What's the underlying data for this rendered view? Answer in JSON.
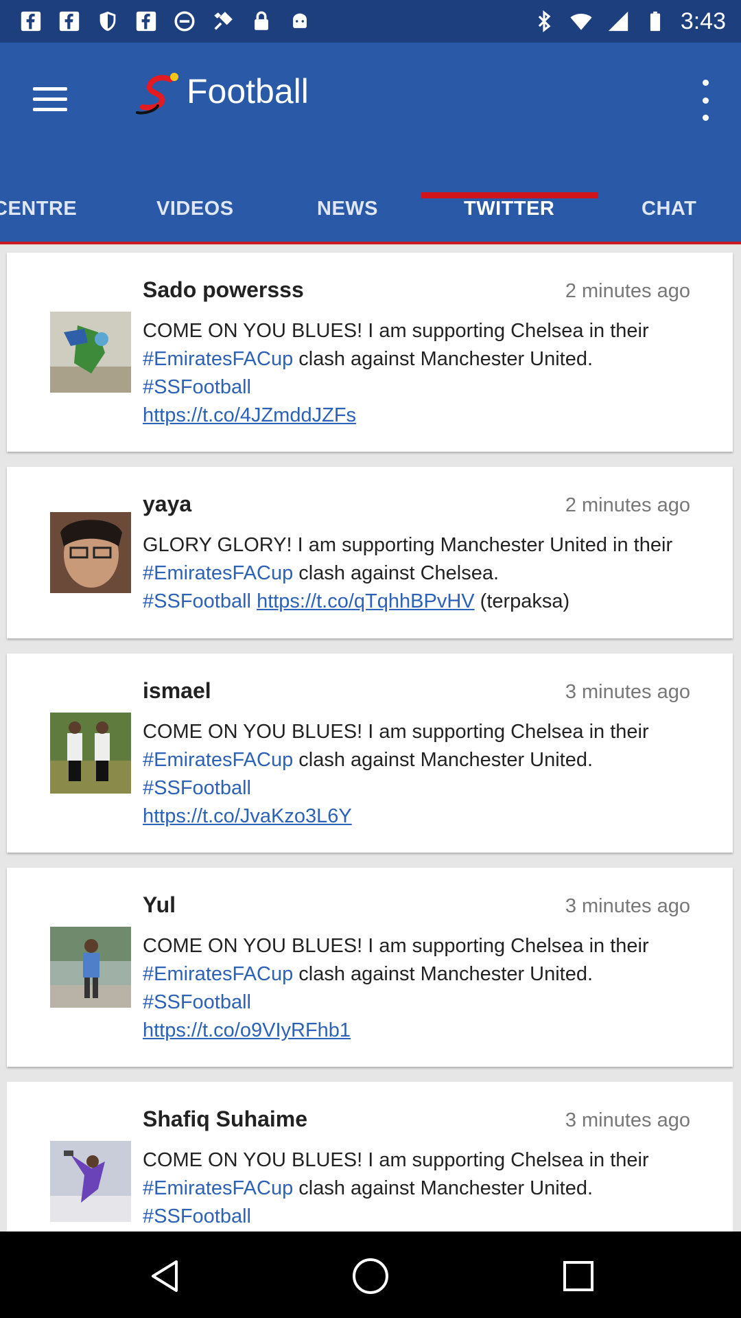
{
  "status_bar": {
    "time": "3:43",
    "icons": [
      "facebook-icon",
      "facebook-icon",
      "shield-icon",
      "facebook-icon",
      "block-icon",
      "fake-gps-icon",
      "lock-icon",
      "android-icon",
      "bluetooth-icon",
      "wifi-icon",
      "signal-icon",
      "battery-icon"
    ]
  },
  "app_bar": {
    "title": "Football",
    "menu_icon": "hamburger-menu-icon",
    "more_icon": "more-vert-icon",
    "brand_color": "#2a5aa7"
  },
  "tabs": [
    {
      "label": "CENTRE"
    },
    {
      "label": "VIDEOS"
    },
    {
      "label": "NEWS"
    },
    {
      "label": "TWITTER"
    },
    {
      "label": "CHAT"
    }
  ],
  "selected_tab": "TWITTER",
  "accent_color": "#d0141b",
  "link_color": "#2c61b8",
  "tweets": [
    {
      "user": "Sado powersss",
      "time": "2 minutes ago",
      "text_1": "COME ON YOU BLUES! I am supporting Chelsea in their ",
      "tag_1": "#EmiratesFACup",
      "text_2": " clash against Manchester United. ",
      "tag_2": "#SSFootball",
      "link": "https://t.co/4JZmddJZFs"
    },
    {
      "user": "yaya",
      "time": "2 minutes ago",
      "text_1": "GLORY GLORY! I am supporting Manchester United in their ",
      "tag_1": "#EmiratesFACup",
      "text_2": " clash against Chelsea. ",
      "tag_2": "#SSFootball",
      "link": "https://t.co/qTqhhBPvHV",
      "text_3": " (terpaksa)"
    },
    {
      "user": "ismael",
      "time": "3 minutes ago",
      "text_1": "COME ON YOU BLUES! I am supporting Chelsea in their ",
      "tag_1": "#EmiratesFACup",
      "text_2": " clash against Manchester United. ",
      "tag_2": "#SSFootball",
      "link": "https://t.co/JvaKzo3L6Y"
    },
    {
      "user": "Yul",
      "time": "3 minutes ago",
      "text_1": "COME ON YOU BLUES! I am supporting Chelsea in their ",
      "tag_1": "#EmiratesFACup",
      "text_2": " clash against Manchester United. ",
      "tag_2": "#SSFootball",
      "link": "https://t.co/o9VIyRFhb1"
    },
    {
      "user": "Shafiq Suhaime",
      "time": "3 minutes ago",
      "text_1": "COME ON YOU BLUES! I am supporting Chelsea in their ",
      "tag_1": "#EmiratesFACup",
      "text_2": " clash against Manchester United. ",
      "tag_2": "#SSFootball"
    }
  ],
  "nav_bar": {
    "icons": [
      "back-icon",
      "home-icon",
      "recents-icon"
    ]
  }
}
